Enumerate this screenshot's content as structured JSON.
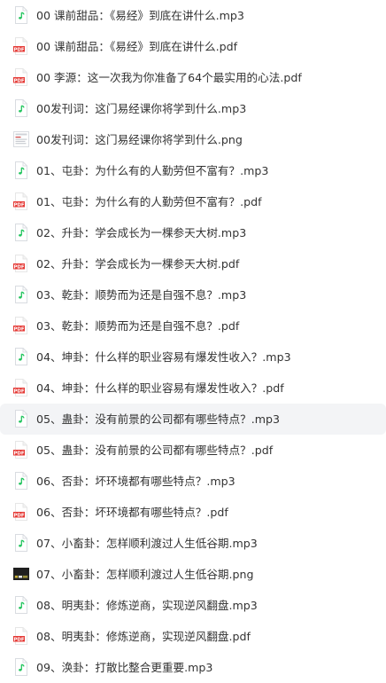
{
  "colors": {
    "mp3_icon_border": "#d9dce1",
    "mp3_note": "#22c55e",
    "pdf_red": "#e53935",
    "text": "#333333",
    "hover_bg": "#f3f4f6"
  },
  "files": [
    {
      "name": "00 课前甜品：《易经》到底在讲什么.mp3",
      "icon": "audio-file-icon"
    },
    {
      "name": "00 课前甜品：《易经》到底在讲什么.pdf",
      "icon": "pdf-file-icon"
    },
    {
      "name": "00 李源：这一次我为你准备了64个最实用的心法.pdf",
      "icon": "pdf-file-icon"
    },
    {
      "name": "00发刊词：这门易经课你将学到什么.mp3",
      "icon": "audio-file-icon"
    },
    {
      "name": "00发刊词：这门易经课你将学到什么.png",
      "icon": "image-file-icon"
    },
    {
      "name": "01、屯卦：为什么有的人勤劳但不富有？.mp3",
      "icon": "audio-file-icon"
    },
    {
      "name": "01、屯卦：为什么有的人勤劳但不富有？.pdf",
      "icon": "pdf-file-icon"
    },
    {
      "name": "02、升卦：学会成长为一棵参天大树.mp3",
      "icon": "audio-file-icon"
    },
    {
      "name": "02、升卦：学会成长为一棵参天大树.pdf",
      "icon": "pdf-file-icon"
    },
    {
      "name": "03、乾卦：顺势而为还是自强不息？.mp3",
      "icon": "audio-file-icon"
    },
    {
      "name": "03、乾卦：顺势而为还是自强不息？.pdf",
      "icon": "pdf-file-icon"
    },
    {
      "name": "04、坤卦：什么样的职业容易有爆发性收入？.mp3",
      "icon": "audio-file-icon"
    },
    {
      "name": "04、坤卦：什么样的职业容易有爆发性收入？.pdf",
      "icon": "pdf-file-icon"
    },
    {
      "name": "05、蛊卦：没有前景的公司都有哪些特点？.mp3",
      "icon": "audio-file-icon",
      "hover": true
    },
    {
      "name": "05、蛊卦：没有前景的公司都有哪些特点？.pdf",
      "icon": "pdf-file-icon"
    },
    {
      "name": "06、否卦：坏环境都有哪些特点？.mp3",
      "icon": "audio-file-icon"
    },
    {
      "name": "06、否卦：坏环境都有哪些特点？.pdf",
      "icon": "pdf-file-icon"
    },
    {
      "name": "07、小畜卦：怎样顺利渡过人生低谷期.mp3",
      "icon": "audio-file-icon"
    },
    {
      "name": "07、小畜卦：怎样顺利渡过人生低谷期.png",
      "icon": "image-thumbnail-icon"
    },
    {
      "name": "08、明夷卦：修炼逆商，实现逆风翻盘.mp3",
      "icon": "audio-file-icon"
    },
    {
      "name": "08、明夷卦：修炼逆商，实现逆风翻盘.pdf",
      "icon": "pdf-file-icon"
    },
    {
      "name": "09、涣卦：打散比整合更重要.mp3",
      "icon": "audio-file-icon"
    }
  ]
}
